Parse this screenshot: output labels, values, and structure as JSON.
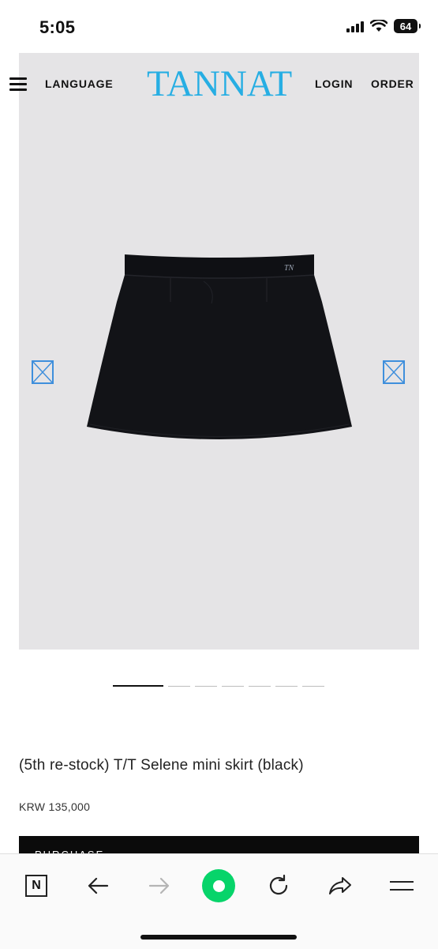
{
  "status_bar": {
    "time": "5:05",
    "battery": "64"
  },
  "header": {
    "language": "LANGUAGE",
    "brand": "TANNAT",
    "login": "LOGIN",
    "order": "ORDER"
  },
  "product": {
    "title": "(5th re-stock) T/T Selene mini skirt (black)",
    "price": "KRW 135,000",
    "buy_label": "PURCHASE"
  },
  "gallery": {
    "total_slides": 7,
    "active_slide": 1
  },
  "colors": {
    "brand": "#27aee3",
    "hero_bg": "#e5e4e6",
    "home_button": "#07d46a",
    "arrow": "#3f8fdc"
  },
  "toolbar": {
    "n_label": "N"
  }
}
